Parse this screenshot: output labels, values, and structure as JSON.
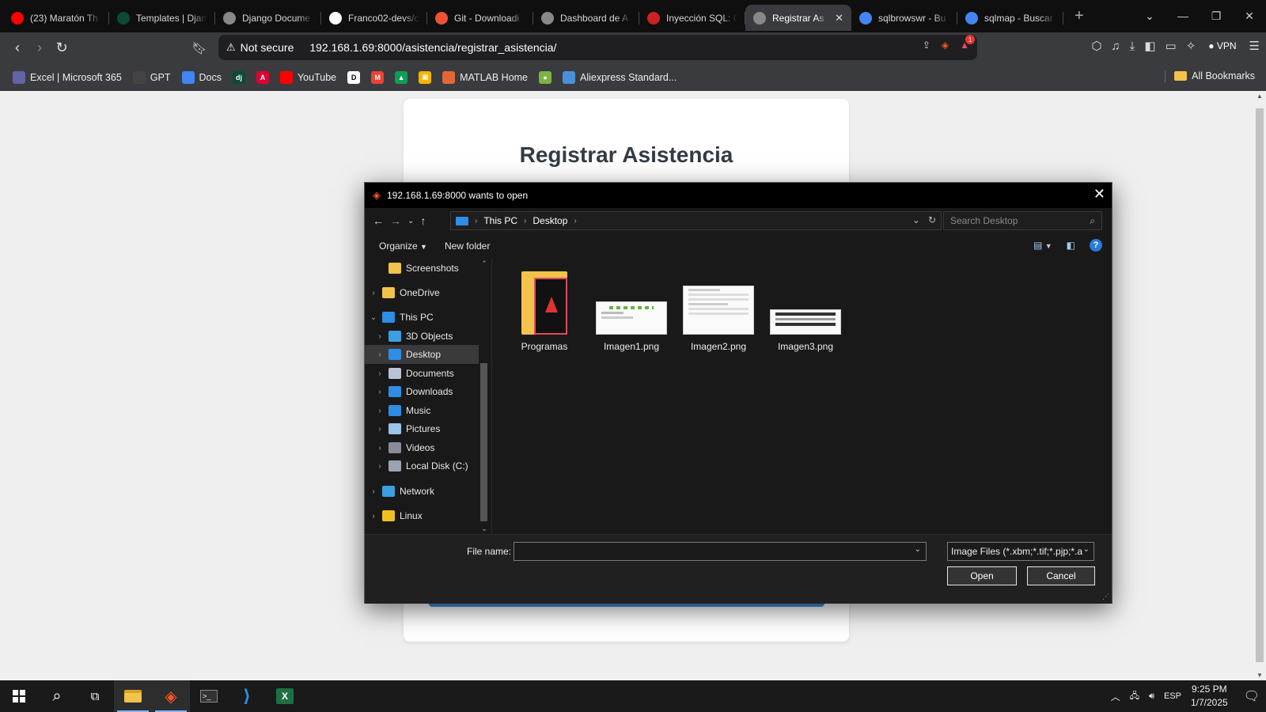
{
  "browser": {
    "tabs": [
      {
        "title": "(23) Maratón Th",
        "favicon": "youtube-icon",
        "color": "#ff0000",
        "active": false
      },
      {
        "title": "Templates | Djan",
        "favicon": "django-icon",
        "color": "#0c4b33",
        "active": false
      },
      {
        "title": "Django Docume",
        "favicon": "globe-icon",
        "color": "#888888",
        "active": false
      },
      {
        "title": "Franco02-devs/c",
        "favicon": "github-icon",
        "color": "#ffffff",
        "active": false
      },
      {
        "title": "Git - Downloadi",
        "favicon": "git-icon",
        "color": "#f05133",
        "active": false
      },
      {
        "title": "Dashboard de A",
        "favicon": "globe-icon",
        "color": "#888888",
        "active": false
      },
      {
        "title": "Inyección SQL: C",
        "favicon": "bookmark-icon",
        "color": "#cc2222",
        "active": false
      },
      {
        "title": "Registrar As",
        "favicon": "globe-icon",
        "color": "#888888",
        "active": true
      },
      {
        "title": "sqlbrowswr - Bu",
        "favicon": "google-icon",
        "color": "#4285f4",
        "active": false
      },
      {
        "title": "sqlmap - Buscar",
        "favicon": "google-icon",
        "color": "#4285f4",
        "active": false
      }
    ],
    "security_label": "Not secure",
    "url": "192.168.1.69:8000/asistencia/registrar_asistencia/",
    "notification_count": "1",
    "vpn_label": "VPN",
    "bookmarks": [
      {
        "label": "Excel | Microsoft 365",
        "color": "#6264a7"
      },
      {
        "label": "GPT",
        "color": "#444444"
      },
      {
        "label": "Docs",
        "color": "#4285f4"
      },
      {
        "label": "",
        "icon_text": "dj",
        "color": "#0c4b33"
      },
      {
        "label": "",
        "icon_text": "A",
        "color": "#dd0031"
      },
      {
        "label": "YouTube",
        "color": "#ff0000"
      },
      {
        "label": "",
        "icon_text": "D",
        "color": "#ffffff"
      },
      {
        "label": "",
        "icon_text": "M",
        "color": "#ea4335"
      },
      {
        "label": "",
        "icon_text": "▲",
        "color": "#0f9d58"
      },
      {
        "label": "",
        "icon_text": "▣",
        "color": "#f4b400"
      },
      {
        "label": "MATLAB Home",
        "color": "#e16737"
      },
      {
        "label": "",
        "icon_text": "●",
        "color": "#7cb342"
      },
      {
        "label": "Aliexpress Standard...",
        "color": "#4a90d9"
      }
    ],
    "all_bookmarks_label": "All Bookmarks"
  },
  "page": {
    "heading": "Registrar Asistencia"
  },
  "dialog": {
    "title": "192.168.1.69:8000 wants to open",
    "path": [
      "This PC",
      "Desktop"
    ],
    "search_placeholder": "Search Desktop",
    "organize_label": "Organize",
    "new_folder_label": "New folder",
    "nav_items": [
      {
        "label": "Screenshots",
        "icon": "folder-icon",
        "color": "#f2c24b",
        "indent": 1,
        "expander": "",
        "selected": false
      },
      {
        "label": "OneDrive",
        "icon": "folder-icon",
        "color": "#f2c24b",
        "indent": 0,
        "expander": "›",
        "selected": false
      },
      {
        "label": "This PC",
        "icon": "computer-icon",
        "color": "#2f8de4",
        "indent": 0,
        "expander": "⌄",
        "selected": false
      },
      {
        "label": "3D Objects",
        "icon": "cube-icon",
        "color": "#3aa0e0",
        "indent": 1,
        "expander": "›",
        "selected": false
      },
      {
        "label": "Desktop",
        "icon": "desktop-icon",
        "color": "#2f8de4",
        "indent": 1,
        "expander": "›",
        "selected": true
      },
      {
        "label": "Documents",
        "icon": "document-icon",
        "color": "#b8c4d6",
        "indent": 1,
        "expander": "›",
        "selected": false
      },
      {
        "label": "Downloads",
        "icon": "download-icon",
        "color": "#2f8de4",
        "indent": 1,
        "expander": "›",
        "selected": false
      },
      {
        "label": "Music",
        "icon": "music-icon",
        "color": "#2f8de4",
        "indent": 1,
        "expander": "›",
        "selected": false
      },
      {
        "label": "Pictures",
        "icon": "pictures-icon",
        "color": "#9bc4e8",
        "indent": 1,
        "expander": "›",
        "selected": false
      },
      {
        "label": "Videos",
        "icon": "video-icon",
        "color": "#8a8a9a",
        "indent": 1,
        "expander": "›",
        "selected": false
      },
      {
        "label": "Local Disk (C:)",
        "icon": "disk-icon",
        "color": "#9aa4b0",
        "indent": 1,
        "expander": "›",
        "selected": false
      },
      {
        "label": "Network",
        "icon": "network-icon",
        "color": "#3aa0e0",
        "indent": 0,
        "expander": "›",
        "selected": false
      },
      {
        "label": "Linux",
        "icon": "linux-icon",
        "color": "#f0c020",
        "indent": 0,
        "expander": "›",
        "selected": false
      }
    ],
    "files": [
      {
        "name": "Programas",
        "type": "folder"
      },
      {
        "name": "Imagen1.png",
        "type": "image"
      },
      {
        "name": "Imagen2.png",
        "type": "image"
      },
      {
        "name": "Imagen3.png",
        "type": "image"
      }
    ],
    "file_name_label": "File name:",
    "file_name_value": "",
    "file_type_value": "Image Files (*.xbm;*.tif;*.pjp;*.a",
    "open_label": "Open",
    "cancel_label": "Cancel"
  },
  "taskbar": {
    "language": "ESP",
    "time": "9:25 PM",
    "date": "1/7/2025"
  },
  "colors": {
    "accent_button": "#3b8fd9",
    "heading_text": "#333c46"
  }
}
